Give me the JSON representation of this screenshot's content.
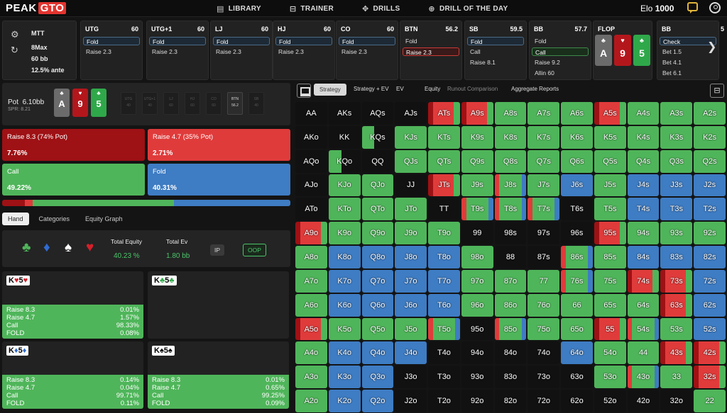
{
  "app": {
    "logo_a": "PEAK",
    "logo_b": "GTO"
  },
  "nav": {
    "items": [
      {
        "label": "LIBRARY",
        "icon": "book-icon"
      },
      {
        "label": "TRAINER",
        "icon": "gamepad-icon"
      },
      {
        "label": "DRILLS",
        "icon": "drill-icon"
      },
      {
        "label": "DRILL OF THE DAY",
        "icon": "plus-circle-icon"
      }
    ]
  },
  "elo": {
    "label": "Elo",
    "value": "1000"
  },
  "game_info": {
    "format": "MTT",
    "table": "8Max",
    "stack": "60 bb",
    "ante": "12.5% ante"
  },
  "seats": [
    {
      "name": "UTG",
      "stack": "60",
      "actions": [
        {
          "t": "Fold",
          "s": "sel"
        },
        {
          "t": "Raise 2.3",
          "s": ""
        }
      ]
    },
    {
      "name": "UTG+1",
      "stack": "60",
      "actions": [
        {
          "t": "Fold",
          "s": "sel"
        },
        {
          "t": "Raise 2.3",
          "s": ""
        }
      ]
    },
    {
      "name": "LJ",
      "stack": "60",
      "actions": [
        {
          "t": "Fold",
          "s": "sel"
        },
        {
          "t": "Raise 2.3",
          "s": ""
        }
      ]
    },
    {
      "name": "HJ",
      "stack": "60",
      "actions": [
        {
          "t": "Fold",
          "s": "sel"
        },
        {
          "t": "Raise 2.3",
          "s": ""
        }
      ]
    },
    {
      "name": "CO",
      "stack": "60",
      "actions": [
        {
          "t": "Fold",
          "s": "sel"
        },
        {
          "t": "Raise 2.3",
          "s": ""
        }
      ]
    },
    {
      "name": "BTN",
      "stack": "56.2",
      "actions": [
        {
          "t": "Fold",
          "s": ""
        },
        {
          "t": "Raise 2.3",
          "s": "selr"
        }
      ]
    },
    {
      "name": "SB",
      "stack": "59.5",
      "actions": [
        {
          "t": "Fold",
          "s": "sel"
        },
        {
          "t": "Call",
          "s": ""
        },
        {
          "t": "Raise 8.1",
          "s": ""
        }
      ]
    },
    {
      "name": "BB",
      "stack": "57.7",
      "actions": [
        {
          "t": "Fold",
          "s": ""
        },
        {
          "t": "Call",
          "s": "selg"
        },
        {
          "t": "Raise 9.2",
          "s": ""
        },
        {
          "t": "Allin 60",
          "s": ""
        }
      ]
    }
  ],
  "flop": {
    "label": "FLOP",
    "cards": [
      {
        "rank": "A",
        "suit": "♣",
        "color": "#6b6b6b"
      },
      {
        "rank": "9",
        "suit": "♥",
        "color": "#b3171c"
      },
      {
        "rank": "5",
        "suit": "♣",
        "color": "#2fa84a"
      }
    ]
  },
  "bb_next": {
    "name": "BB",
    "stack": "5",
    "actions": [
      {
        "t": "Check",
        "s": "sel"
      },
      {
        "t": "Bet 1.5",
        "s": ""
      },
      {
        "t": "Bet 4.1",
        "s": ""
      },
      {
        "t": "Bet 6.1",
        "s": ""
      }
    ]
  },
  "pot": {
    "label": "Pot",
    "value": "6.10bb",
    "spr": "SPR: 8.21"
  },
  "mini_seats": [
    {
      "n": "UTG",
      "v": "40"
    },
    {
      "n": "UTG+1",
      "v": "40"
    },
    {
      "n": "LJ",
      "v": "60"
    },
    {
      "n": "HJ",
      "v": "60"
    },
    {
      "n": "CO",
      "v": "60"
    },
    {
      "n": "BTN",
      "v": "56.2",
      "on": true
    },
    {
      "n": "SB",
      "v": "40"
    }
  ],
  "actions": [
    {
      "label": "Raise 8.3 (74% Pot)",
      "value": "7.76%",
      "color": "#9e1114"
    },
    {
      "label": "Raise 4.7 (35% Pot)",
      "value": "2.71%",
      "color": "#e03b3b"
    },
    {
      "label": "Call",
      "value": "49.22%",
      "color": "#4fb55a"
    },
    {
      "label": "Fold",
      "value": "40.31%",
      "color": "#3e7cc3"
    }
  ],
  "freq": [
    7.76,
    2.71,
    49.22,
    40.31
  ],
  "subtabs": [
    "Hand",
    "Categories",
    "Equity Graph"
  ],
  "equity": {
    "suits": [
      {
        "g": "♣",
        "c": "#4fb55a"
      },
      {
        "g": "♦",
        "c": "#2f6bd1"
      },
      {
        "g": "♠",
        "c": "#ffffff"
      },
      {
        "g": "♥",
        "c": "#d5202a"
      }
    ],
    "total_equity_label": "Total Equity",
    "total_equity": "40.23 %",
    "total_ev_label": "Total Ev",
    "total_ev": "1.80 bb",
    "ip": "IP",
    "oop": "OOP"
  },
  "combos": [
    {
      "rank1": "K",
      "suit1": "♥",
      "rank2": "5",
      "suit2": "♥",
      "suit_color": "#d5202a",
      "stats": [
        [
          "Raise 8.3",
          "0.01%"
        ],
        [
          "Raise 4.7",
          "1.57%"
        ],
        [
          "Call",
          "98.33%"
        ],
        [
          "FOLD",
          "0.08%"
        ]
      ]
    },
    {
      "rank1": "K",
      "suit1": "♣",
      "rank2": "5",
      "suit2": "♣",
      "suit_color": "#2fa84a",
      "stats": []
    },
    {
      "rank1": "K",
      "suit1": "♦",
      "rank2": "5",
      "suit2": "♦",
      "suit_color": "#2f6bd1",
      "stats": [
        [
          "Raise 8.3",
          "0.14%"
        ],
        [
          "Raise 4.7",
          "0.04%"
        ],
        [
          "Call",
          "99.71%"
        ],
        [
          "FOLD",
          "0.11%"
        ]
      ]
    },
    {
      "rank1": "K",
      "suit1": "♠",
      "rank2": "5",
      "suit2": "♠",
      "suit_color": "#000000",
      "stats": [
        [
          "Raise 8.3",
          "0.01%"
        ],
        [
          "Raise 4.7",
          "0.65%"
        ],
        [
          "Call",
          "99.25%"
        ],
        [
          "FOLD",
          "0.09%"
        ]
      ]
    }
  ],
  "strategy_tabs": [
    {
      "t": "Strategy",
      "active": true
    },
    {
      "t": "Strategy + EV"
    },
    {
      "t": "EV"
    },
    {
      "t": "Equity"
    },
    {
      "t": "Runout Comparison",
      "dim": true
    },
    {
      "t": "Aggregate Reports"
    }
  ],
  "colors": {
    "raise_big": "#9e1114",
    "raise_small": "#e03b3b",
    "call": "#4fb55a",
    "fold": "#3e7cc3"
  },
  "grid": {
    "ranks": [
      "A",
      "K",
      "Q",
      "J",
      "T",
      "9",
      "8",
      "7",
      "6",
      "5",
      "4",
      "3",
      "2"
    ],
    "cells": [
      [
        "",
        "",
        "",
        "",
        "r",
        "r",
        "c",
        "c",
        "c",
        "r",
        "c",
        "c",
        "c"
      ],
      [
        "",
        "",
        "g",
        "c",
        "c",
        "c",
        "c",
        "c",
        "c",
        "c",
        "c",
        "c",
        "c"
      ],
      [
        "",
        "g",
        "",
        "c",
        "c",
        "c",
        "c",
        "c",
        "c",
        "c",
        "c",
        "c",
        "c"
      ],
      [
        "",
        "c",
        "c",
        "",
        "r",
        "c",
        "m",
        "c",
        "f",
        "c",
        "f",
        "f",
        "f"
      ],
      [
        "",
        "c",
        "c",
        "c",
        "",
        "m",
        "m",
        "m",
        "",
        "c",
        "f",
        "f",
        "f"
      ],
      [
        "r",
        "c",
        "c",
        "c",
        "c",
        "",
        "",
        "",
        "",
        "r",
        "c",
        "c",
        "c"
      ],
      [
        "c",
        "f",
        "f",
        "f",
        "f",
        "c",
        "",
        "",
        "m",
        "c",
        "f",
        "f",
        "f"
      ],
      [
        "c",
        "f",
        "f",
        "f",
        "f",
        "c",
        "c",
        "c",
        "m",
        "c",
        "r",
        "r",
        "f"
      ],
      [
        "c",
        "f",
        "f",
        "f",
        "f",
        "c",
        "c",
        "c",
        "c",
        "c",
        "c",
        "r",
        "f"
      ],
      [
        "r",
        "c",
        "c",
        "c",
        "m",
        "",
        "m",
        "c",
        "c",
        "r",
        "m",
        "c",
        "f"
      ],
      [
        "c",
        "f",
        "f",
        "f",
        "",
        "",
        "",
        "",
        "f",
        "c",
        "c",
        "r",
        "r"
      ],
      [
        "c",
        "f",
        "f",
        "",
        "",
        "",
        "",
        "",
        "",
        "c",
        "m",
        "c",
        "r"
      ],
      [
        "c",
        "f",
        "f",
        "",
        "",
        "",
        "",
        "",
        "",
        "",
        "",
        "",
        "c"
      ]
    ]
  }
}
